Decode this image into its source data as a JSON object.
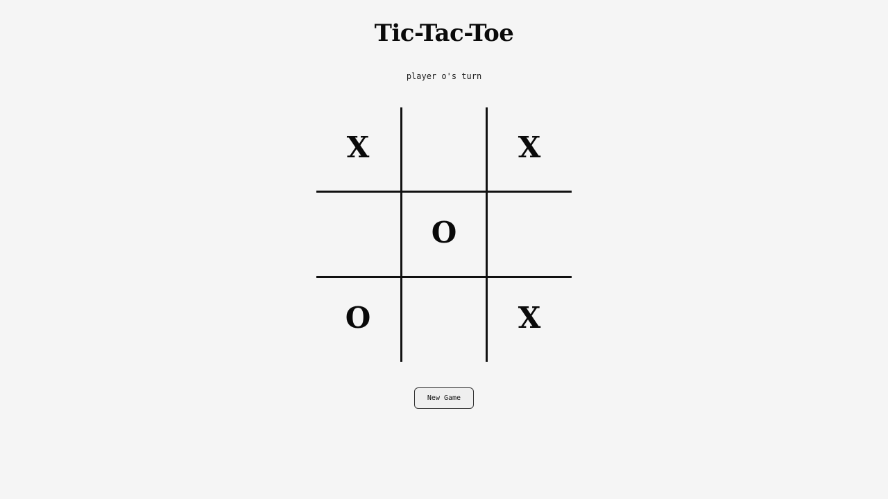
{
  "title": "Tic-Tac-Toe",
  "status": "player o's turn",
  "board": {
    "cells": [
      "X",
      "",
      "X",
      "",
      "O",
      "",
      "O",
      "",
      "X"
    ]
  },
  "new_game_label": "New Game"
}
